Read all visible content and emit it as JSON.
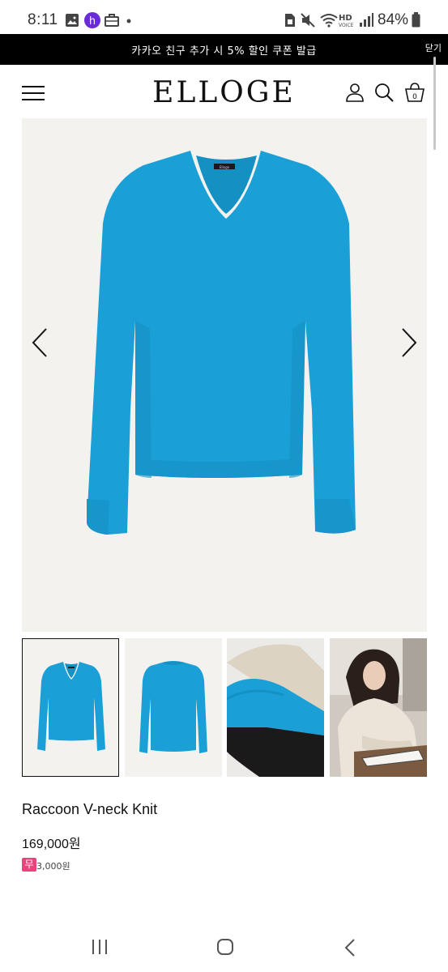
{
  "status_bar": {
    "time": "8:11",
    "battery": "84%",
    "icons": [
      "gallery-icon",
      "app-notification-icon",
      "briefcase-icon",
      "dot-icon",
      "sim-icon",
      "mute-icon",
      "wifi-icon",
      "hd-voice-icon",
      "signal-icon",
      "battery-icon"
    ]
  },
  "promo": {
    "text": "카카오 친구 추가 시 5% 할인 쿠폰 발급",
    "close_label": "닫기"
  },
  "header": {
    "logo": "ELLOGE",
    "cart_count": "0",
    "icons": [
      "menu-icon",
      "user-icon",
      "search-icon",
      "cart-icon"
    ]
  },
  "gallery": {
    "main_image": "blue-v-neck-sweater",
    "thumbnails": [
      "front-view",
      "back-view",
      "fabric-detail",
      "model-wearing"
    ],
    "active_index": 0,
    "tag_text": "Elloge",
    "colors": {
      "sweater": "#1aa0d6",
      "background": "#f3f2ef"
    }
  },
  "product": {
    "name": "Raccoon V-neck Knit",
    "price": "169,000원",
    "shipping_badge": "무",
    "shipping_fee": "3,000원"
  },
  "nav": {
    "icons": [
      "recent-apps-icon",
      "home-icon",
      "back-icon"
    ]
  }
}
